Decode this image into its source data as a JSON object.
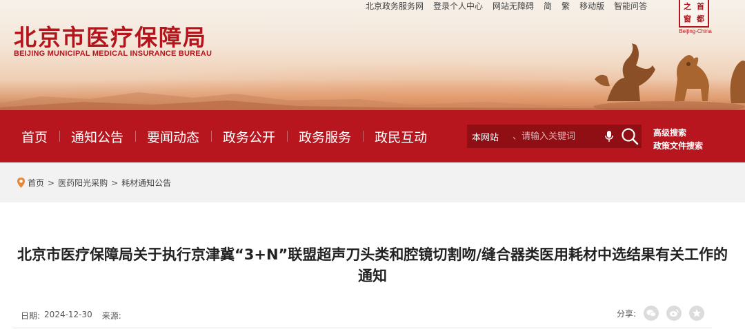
{
  "header": {
    "logo_cn": "北京市医疗保障局",
    "logo_en": "BEIJING MUNICIPAL MEDICAL INSURANCE BUREAU",
    "top_links": [
      "北京政务服务网",
      "登录个人中心",
      "网站无障碍",
      "简",
      "繁",
      "移动版",
      "智能问答"
    ],
    "seal": {
      "chars": [
        "首",
        "都",
        "之",
        "窗"
      ],
      "caption": "Beijing-China"
    }
  },
  "nav": {
    "items": [
      "首页",
      "通知公告",
      "要闻动态",
      "政务公开",
      "政务服务",
      "政民互动"
    ],
    "search": {
      "scope": "本网站",
      "placeholder": "、请输入关键词"
    },
    "advanced": [
      "高级搜索",
      "政策文件搜索"
    ]
  },
  "breadcrumb": [
    "首页",
    "医药阳光采购",
    "耗材通知公告"
  ],
  "article": {
    "title": "北京市医疗保障局关于执行京津冀“3+N”联盟超声刀头类和腔镜切割吻/缝合器类医用耗材中选结果有关工作的通知",
    "date_label": "日期:",
    "date": "2024-12-30",
    "source_label": "来源:",
    "source": "",
    "share_label": "分享:"
  },
  "colors": {
    "brand_red": "#b8161e",
    "search_bg": "#8f0f15",
    "crumb_bg": "#f2f2f2"
  },
  "icons": [
    "location-pin-icon",
    "microphone-icon",
    "search-icon",
    "wechat-icon",
    "weibo-icon",
    "star-icon"
  ]
}
